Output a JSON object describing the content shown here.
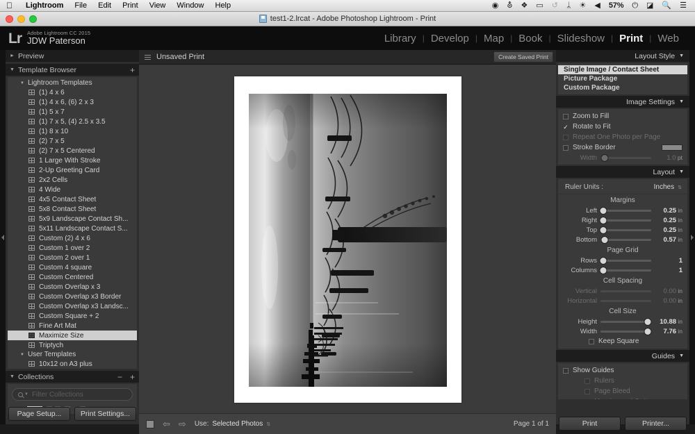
{
  "menubar": {
    "apple_icon": "apple-icon",
    "items": [
      {
        "label": "Lightroom",
        "bold": true
      },
      {
        "label": "File",
        "bold": false
      },
      {
        "label": "Edit",
        "bold": false
      },
      {
        "label": "Print",
        "bold": false
      },
      {
        "label": "View",
        "bold": false
      },
      {
        "label": "Window",
        "bold": false
      },
      {
        "label": "Help",
        "bold": false
      }
    ],
    "status_icons": [
      {
        "name": "vpn-eye-icon",
        "glyph": "◉"
      },
      {
        "name": "shield-icon",
        "glyph": "⛊"
      },
      {
        "name": "dropbox-icon",
        "glyph": "❖"
      },
      {
        "name": "airplay-icon",
        "glyph": "▭"
      },
      {
        "name": "time-machine-icon",
        "glyph": "↺"
      },
      {
        "name": "bluetooth-icon",
        "glyph": "ᛦ"
      },
      {
        "name": "wifi-icon",
        "glyph": "◠"
      },
      {
        "name": "volume-icon",
        "glyph": "◀"
      }
    ],
    "battery": "57%",
    "battery_icon": "battery-charging-icon",
    "clock_icon": "clock-icon",
    "search_icon": "spotlight-search-icon",
    "notification_icon": "notification-center-icon"
  },
  "window": {
    "title": "test1-2.lrcat - Adobe Photoshop Lightroom - Print",
    "doc_icon": "catalog-file-icon",
    "traffic_lights": [
      "close-button",
      "minimize-button",
      "zoom-button"
    ]
  },
  "identity": {
    "logo": "Lr",
    "app_name": "Adobe Lightroom CC 2015",
    "user_name": "JDW Paterson"
  },
  "modules": [
    {
      "label": "Library",
      "active": false
    },
    {
      "label": "Develop",
      "active": false
    },
    {
      "label": "Map",
      "active": false
    },
    {
      "label": "Book",
      "active": false
    },
    {
      "label": "Slideshow",
      "active": false
    },
    {
      "label": "Print",
      "active": true
    },
    {
      "label": "Web",
      "active": false
    }
  ],
  "left_panel": {
    "preview": {
      "title": "Preview",
      "expanded": false
    },
    "template_browser": {
      "title": "Template Browser",
      "add_icon": "plus-icon",
      "groups": [
        {
          "name": "Lightroom Templates",
          "expanded": true,
          "items": [
            {
              "label": "(1) 4 x 6",
              "selected": false
            },
            {
              "label": "(1) 4 x 6, (6) 2 x 3",
              "selected": false
            },
            {
              "label": "(1) 5 x 7",
              "selected": false
            },
            {
              "label": "(1) 7 x 5, (4) 2.5 x 3.5",
              "selected": false
            },
            {
              "label": "(1) 8 x 10",
              "selected": false
            },
            {
              "label": "(2) 7 x 5",
              "selected": false
            },
            {
              "label": "(2) 7 x 5 Centered",
              "selected": false
            },
            {
              "label": "1 Large With Stroke",
              "selected": false
            },
            {
              "label": "2-Up Greeting Card",
              "selected": false
            },
            {
              "label": "2x2 Cells",
              "selected": false
            },
            {
              "label": "4 Wide",
              "selected": false
            },
            {
              "label": "4x5 Contact Sheet",
              "selected": false
            },
            {
              "label": "5x8 Contact Sheet",
              "selected": false
            },
            {
              "label": "5x9 Landscape Contact Sh...",
              "selected": false
            },
            {
              "label": "5x11 Landscape Contact S...",
              "selected": false
            },
            {
              "label": "Custom (2) 4 x 6",
              "selected": false
            },
            {
              "label": "Custom 1 over 2",
              "selected": false
            },
            {
              "label": "Custom 2 over 1",
              "selected": false
            },
            {
              "label": "Custom 4 square",
              "selected": false
            },
            {
              "label": "Custom Centered",
              "selected": false
            },
            {
              "label": "Custom Overlap x 3",
              "selected": false
            },
            {
              "label": "Custom Overlap x3 Border",
              "selected": false
            },
            {
              "label": "Custom Overlap x3 Landsc...",
              "selected": false
            },
            {
              "label": "Custom Square + 2",
              "selected": false
            },
            {
              "label": "Fine Art Mat",
              "selected": false
            },
            {
              "label": "Maximize Size",
              "selected": true
            },
            {
              "label": "Triptych",
              "selected": false
            }
          ]
        },
        {
          "name": "User Templates",
          "expanded": true,
          "items": [
            {
              "label": "10x12 on A3 plus",
              "selected": false
            }
          ]
        }
      ]
    },
    "collections": {
      "title": "Collections",
      "remove_icon": "minus-icon",
      "add_icon": "plus-icon",
      "filter_placeholder": "Filter Collections"
    },
    "buttons": [
      {
        "label": "Page Setup...",
        "name": "page-setup-button"
      },
      {
        "label": "Print Settings...",
        "name": "print-settings-button"
      }
    ]
  },
  "content": {
    "filmstrip_title": "Unsaved Print",
    "create_saved_print": "Create Saved Print",
    "photo_alt": "black-and-white long exposure seascape with pier and posts, rotated 90 degrees"
  },
  "bottom_toolbar": {
    "grid_icon": "page-thumbnail-icon",
    "prev_icon": "previous-page-arrow-icon",
    "next_icon": "next-page-arrow-icon",
    "use_label": "Use:",
    "use_value": "Selected Photos",
    "page_indicator": "Page 1 of 1"
  },
  "right_panel": {
    "layout_style": {
      "title": "Layout Style",
      "options": [
        {
          "label": "Single Image / Contact Sheet",
          "selected": true
        },
        {
          "label": "Picture Package",
          "selected": false
        },
        {
          "label": "Custom Package",
          "selected": false
        }
      ]
    },
    "image_settings": {
      "title": "Image Settings",
      "checkboxes": [
        {
          "label": "Zoom to Fill",
          "checked": false,
          "disabled": false
        },
        {
          "label": "Rotate to Fit",
          "checked": true,
          "disabled": false
        },
        {
          "label": "Repeat One Photo per Page",
          "checked": false,
          "disabled": true
        },
        {
          "label": "Stroke Border",
          "checked": false,
          "disabled": false
        }
      ],
      "stroke_color": "#8a8a8a",
      "stroke_width": {
        "label": "Width",
        "value": "1.0",
        "unit": "pt",
        "pos": 8,
        "disabled": true
      }
    },
    "layout": {
      "title": "Layout",
      "ruler_units_label": "Ruler Units :",
      "ruler_units_value": "Inches",
      "margins_label": "Margins",
      "margins": [
        {
          "label": "Left",
          "value": "0.25",
          "unit": "in",
          "pos": 6
        },
        {
          "label": "Right",
          "value": "0.25",
          "unit": "in",
          "pos": 6
        },
        {
          "label": "Top",
          "value": "0.25",
          "unit": "in",
          "pos": 6
        },
        {
          "label": "Bottom",
          "value": "0.57",
          "unit": "in",
          "pos": 8
        }
      ],
      "page_grid_label": "Page Grid",
      "page_grid": [
        {
          "label": "Rows",
          "value": "1",
          "unit": "",
          "pos": 6
        },
        {
          "label": "Columns",
          "value": "1",
          "unit": "",
          "pos": 6
        }
      ],
      "cell_spacing_label": "Cell Spacing",
      "cell_spacing": [
        {
          "label": "Vertical",
          "value": "0.00",
          "unit": "in",
          "pos": 0,
          "disabled": true
        },
        {
          "label": "Horizontal",
          "value": "0.00",
          "unit": "in",
          "pos": 0,
          "disabled": true
        }
      ],
      "cell_size_label": "Cell Size",
      "cell_size": [
        {
          "label": "Height",
          "value": "10.88",
          "unit": "in",
          "pos": 93
        },
        {
          "label": "Width",
          "value": "7.76",
          "unit": "in",
          "pos": 93
        }
      ],
      "keep_square": {
        "label": "Keep Square",
        "checked": false
      }
    },
    "guides": {
      "title": "Guides",
      "show_guides": {
        "label": "Show Guides",
        "checked": false
      },
      "items": [
        {
          "label": "Rulers",
          "checked": false,
          "disabled": true
        },
        {
          "label": "Page Bleed",
          "checked": false,
          "disabled": true
        },
        {
          "label": "Margins and Gutters",
          "checked": false,
          "disabled": true
        }
      ]
    },
    "buttons": [
      {
        "label": "Print",
        "name": "print-button"
      },
      {
        "label": "Printer...",
        "name": "printer-button"
      }
    ]
  }
}
